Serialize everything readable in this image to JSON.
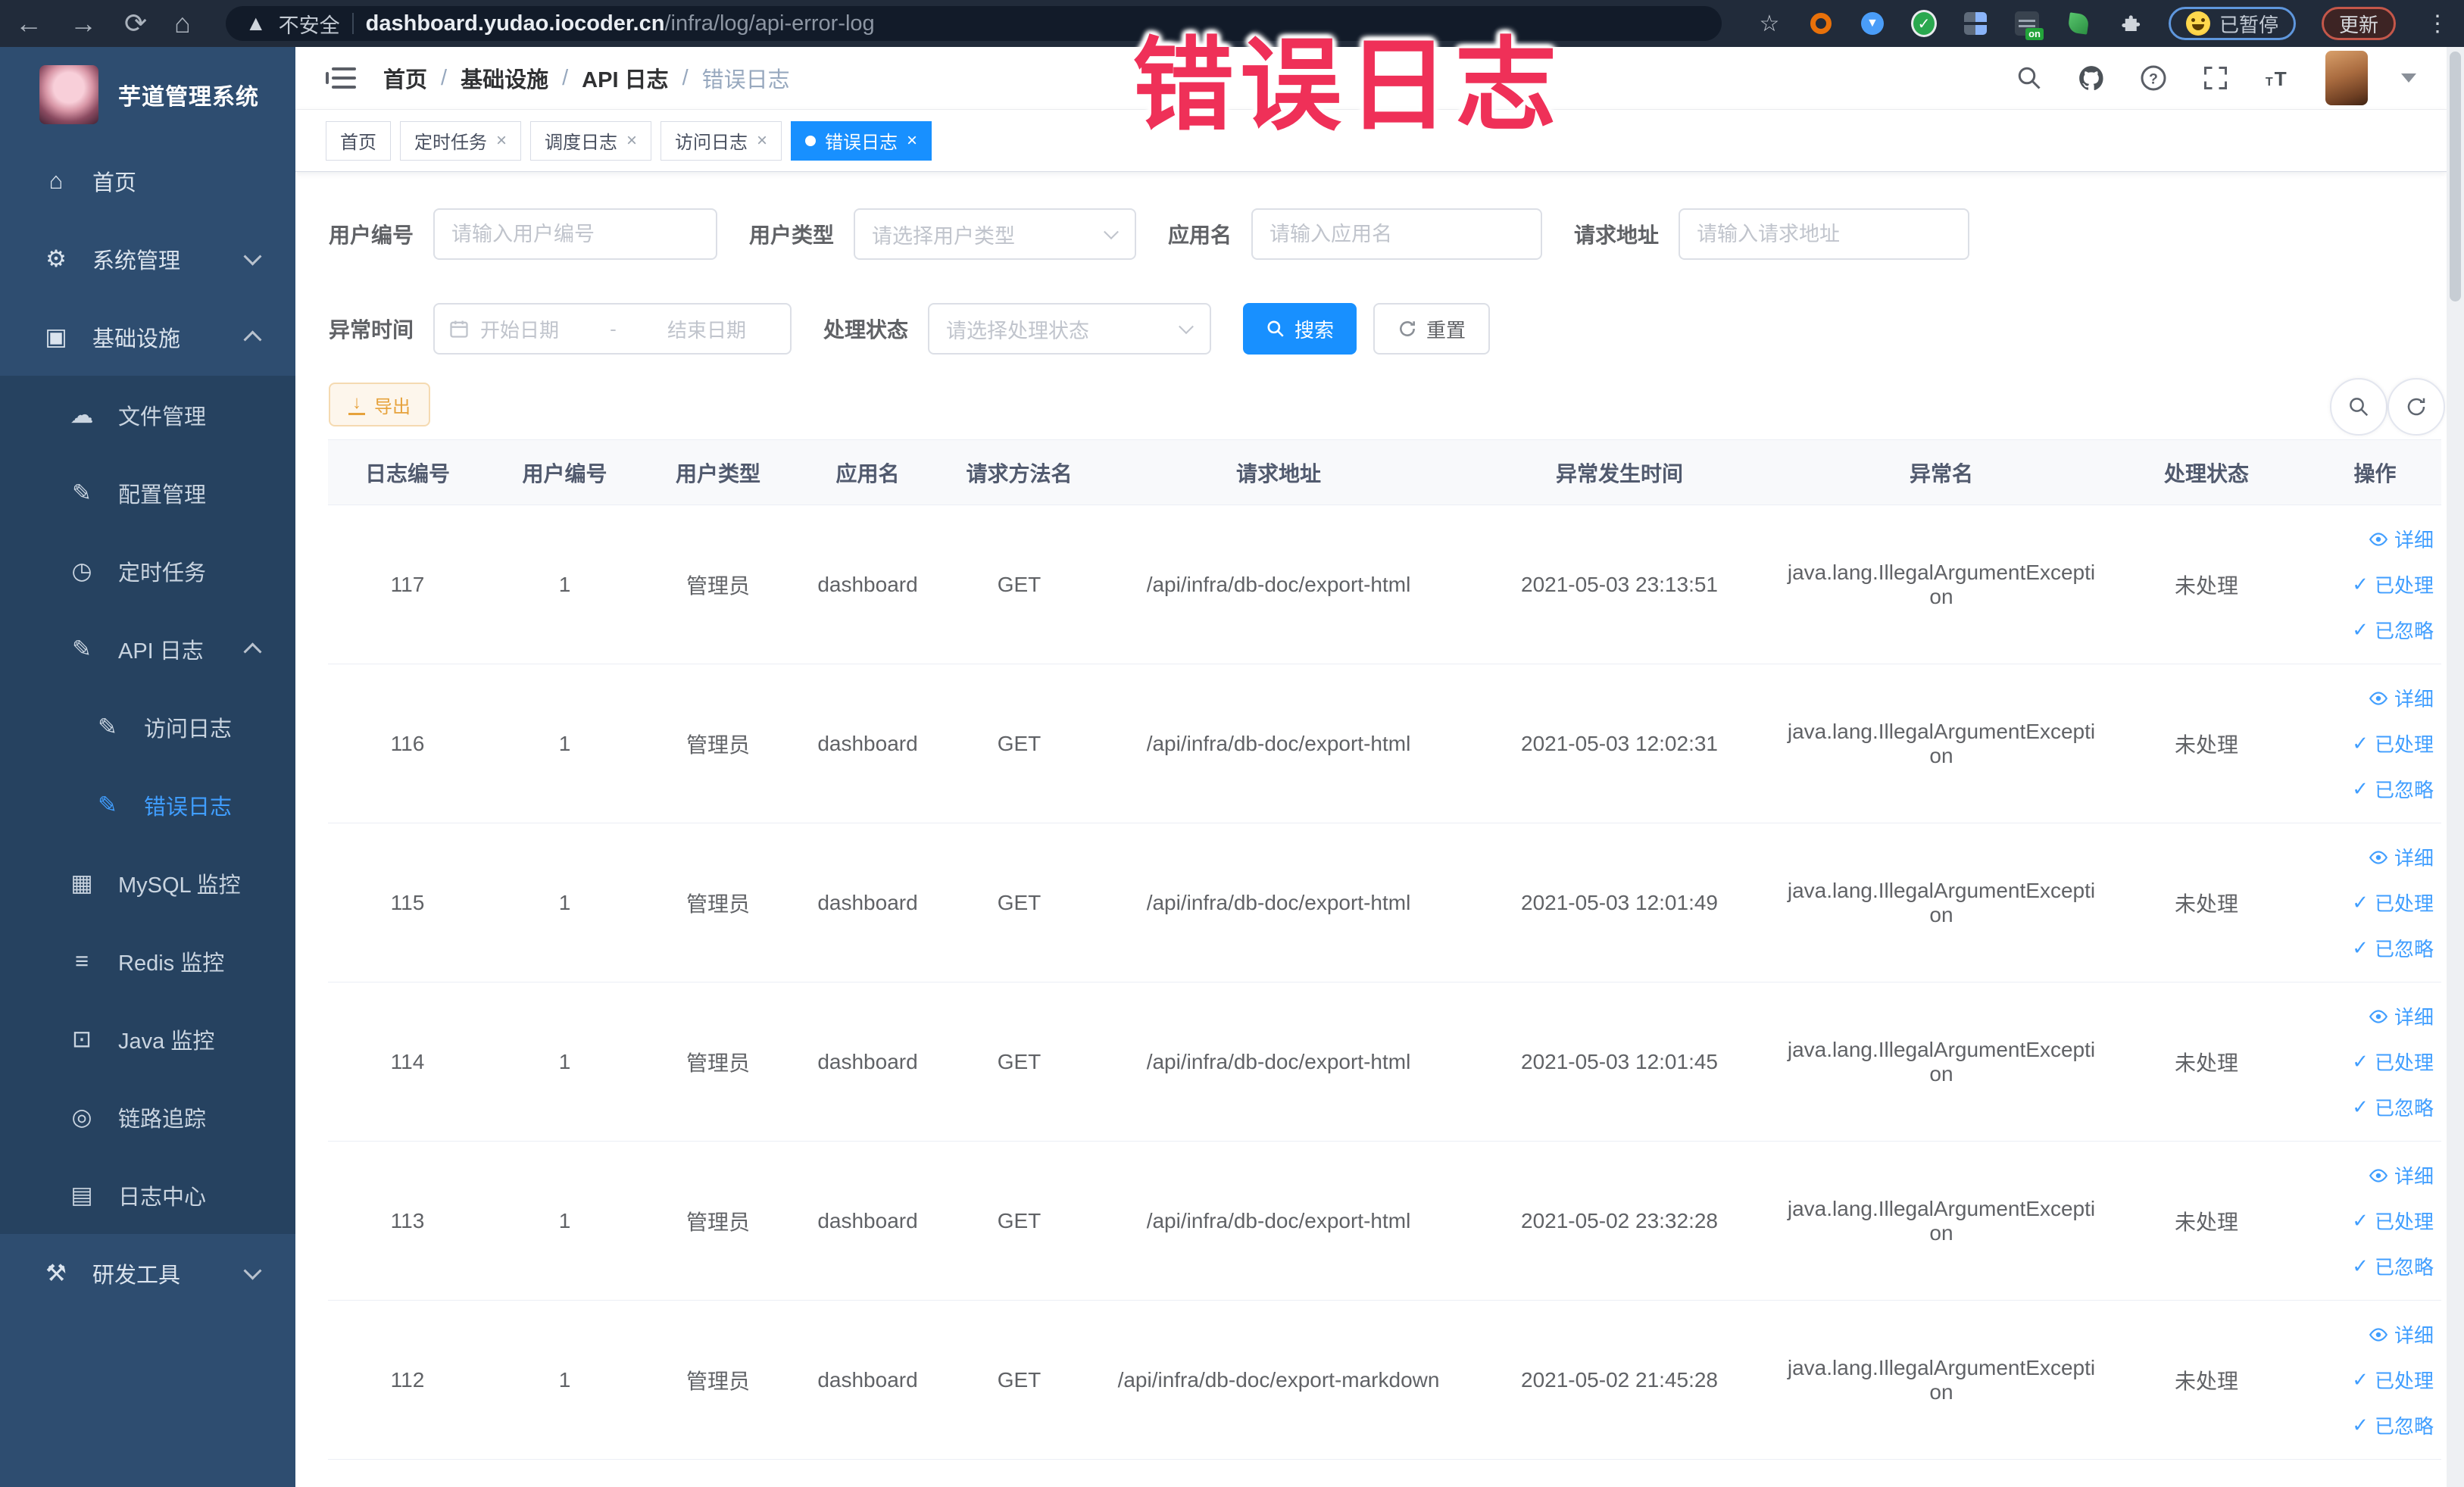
{
  "annotation": {
    "text": "错误日志"
  },
  "browser": {
    "security_label": "不安全",
    "url_host": "dashboard.yudao.iocoder.cn",
    "url_path": "/infra/log/api-error-log",
    "paused_badge": "已暂停",
    "update_label": "更新"
  },
  "sidebar": {
    "title": "芋道管理系统",
    "items": [
      {
        "label": "首页",
        "icon": "home",
        "level": 1
      },
      {
        "label": "系统管理",
        "icon": "gear",
        "level": 1,
        "arrow": "down"
      },
      {
        "label": "基础设施",
        "icon": "infra",
        "level": 1,
        "arrow": "up"
      },
      {
        "label": "文件管理",
        "icon": "file",
        "level": 2,
        "sub": true
      },
      {
        "label": "配置管理",
        "icon": "config",
        "level": 2,
        "sub": true
      },
      {
        "label": "定时任务",
        "icon": "job",
        "level": 2,
        "sub": true
      },
      {
        "label": "API 日志",
        "icon": "apilog",
        "level": 2,
        "sub": true,
        "arrow": "up"
      },
      {
        "label": "访问日志",
        "icon": "access",
        "level": 3,
        "sub": true
      },
      {
        "label": "错误日志",
        "icon": "error",
        "level": 3,
        "sub": true,
        "active": true
      },
      {
        "label": "MySQL 监控",
        "icon": "mysql",
        "level": 2,
        "sub": true
      },
      {
        "label": "Redis 监控",
        "icon": "redis",
        "level": 2,
        "sub": true
      },
      {
        "label": "Java 监控",
        "icon": "java",
        "level": 2,
        "sub": true
      },
      {
        "label": "链路追踪",
        "icon": "trace",
        "level": 2,
        "sub": true
      },
      {
        "label": "日志中心",
        "icon": "logcenter",
        "level": 2,
        "sub": true
      },
      {
        "label": "研发工具",
        "icon": "devtool",
        "level": 1,
        "arrow": "down"
      }
    ]
  },
  "header": {
    "breadcrumb": [
      "首页",
      "基础设施",
      "API 日志",
      "错误日志"
    ]
  },
  "tabs": [
    {
      "label": "首页",
      "closable": false,
      "active": false
    },
    {
      "label": "定时任务",
      "closable": true,
      "active": false
    },
    {
      "label": "调度日志",
      "closable": true,
      "active": false
    },
    {
      "label": "访问日志",
      "closable": true,
      "active": false
    },
    {
      "label": "错误日志",
      "closable": true,
      "active": true
    }
  ],
  "filters": {
    "user_id": {
      "label": "用户编号",
      "placeholder": "请输入用户编号"
    },
    "user_type": {
      "label": "用户类型",
      "placeholder": "请选择用户类型"
    },
    "app_name": {
      "label": "应用名",
      "placeholder": "请输入应用名"
    },
    "request_url": {
      "label": "请求地址",
      "placeholder": "请输入请求地址"
    },
    "exception_time": {
      "label": "异常时间",
      "start_placeholder": "开始日期",
      "separator": "-",
      "end_placeholder": "结束日期"
    },
    "process_status": {
      "label": "处理状态",
      "placeholder": "请选择处理状态"
    },
    "search_label": "搜索",
    "reset_label": "重置"
  },
  "toolbar": {
    "export_label": "导出"
  },
  "table": {
    "headers": [
      "日志编号",
      "用户编号",
      "用户类型",
      "应用名",
      "请求方法名",
      "请求地址",
      "异常发生时间",
      "异常名",
      "处理状态",
      "操作"
    ],
    "rows": [
      [
        "117",
        "1",
        "管理员",
        "dashboard",
        "GET",
        "/api/infra/db-doc/export-html",
        "2021-05-03 23:13:51",
        "java.lang.IllegalArgumentException",
        "未处理"
      ],
      [
        "116",
        "1",
        "管理员",
        "dashboard",
        "GET",
        "/api/infra/db-doc/export-html",
        "2021-05-03 12:02:31",
        "java.lang.IllegalArgumentException",
        "未处理"
      ],
      [
        "115",
        "1",
        "管理员",
        "dashboard",
        "GET",
        "/api/infra/db-doc/export-html",
        "2021-05-03 12:01:49",
        "java.lang.IllegalArgumentException",
        "未处理"
      ],
      [
        "114",
        "1",
        "管理员",
        "dashboard",
        "GET",
        "/api/infra/db-doc/export-html",
        "2021-05-03 12:01:45",
        "java.lang.IllegalArgumentException",
        "未处理"
      ],
      [
        "113",
        "1",
        "管理员",
        "dashboard",
        "GET",
        "/api/infra/db-doc/export-html",
        "2021-05-02 23:32:28",
        "java.lang.IllegalArgumentException",
        "未处理"
      ],
      [
        "112",
        "1",
        "管理员",
        "dashboard",
        "GET",
        "/api/infra/db-doc/export-markdown",
        "2021-05-02 21:45:28",
        "java.lang.IllegalArgumentException",
        "未处理"
      ]
    ],
    "row_actions": [
      "详细",
      "已处理",
      "已忽略"
    ]
  },
  "colors": {
    "accent": "#1890ff",
    "link": "#409eff",
    "annotation": "#ef3058",
    "warning": "#e6a23c"
  }
}
